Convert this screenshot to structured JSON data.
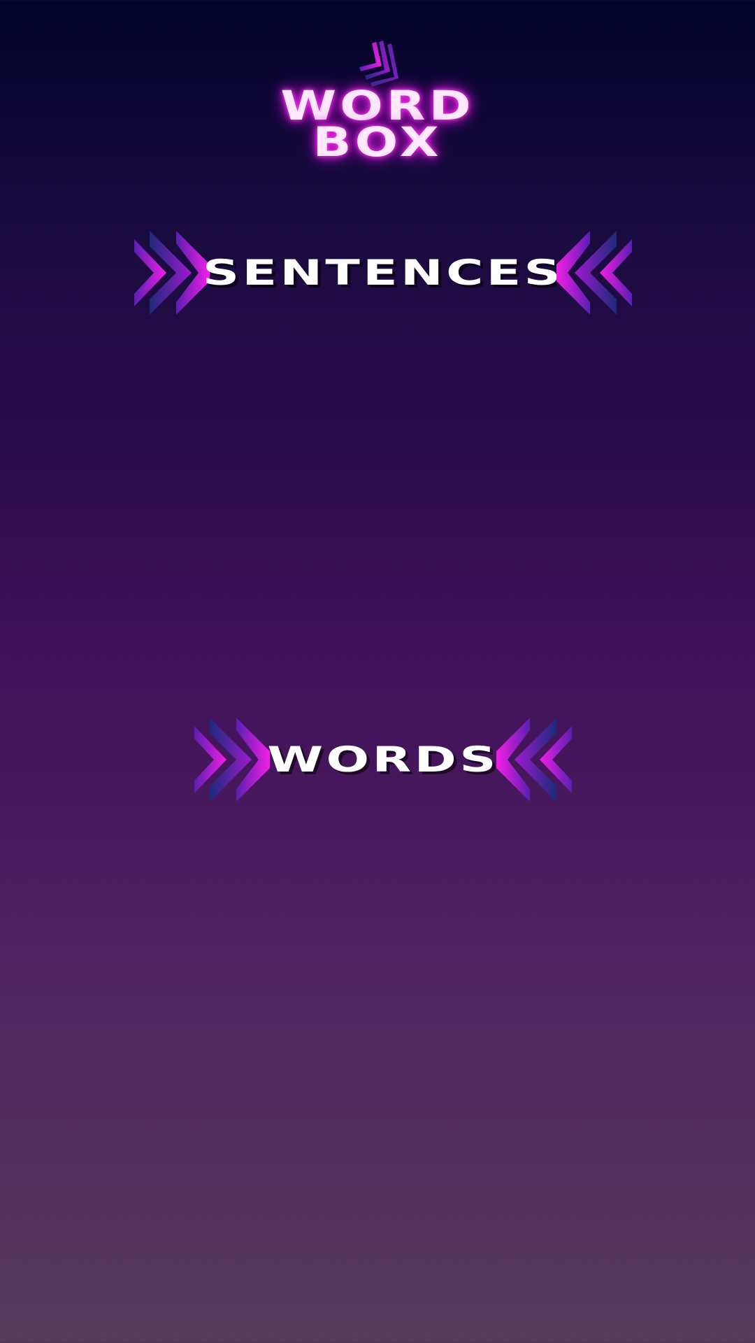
{
  "app": {
    "logo": {
      "line1": "WORD",
      "line2": "BOX",
      "icon": "triple-chevron-icon"
    }
  },
  "menu": {
    "items": [
      {
        "label": "SENTENCES",
        "icon_left": "chevrons-right-icon",
        "icon_right": "chevrons-left-icon"
      },
      {
        "label": "WORDS",
        "icon_left": "chevrons-right-icon",
        "icon_right": "chevrons-left-icon"
      }
    ]
  },
  "colors": {
    "background_top": "#03042a",
    "background_mid": "#3e0f5a",
    "background_bottom": "#573a5c",
    "accent_magenta": "#e31be0",
    "accent_blue": "#2a2a8a",
    "text": "#ffffff"
  }
}
